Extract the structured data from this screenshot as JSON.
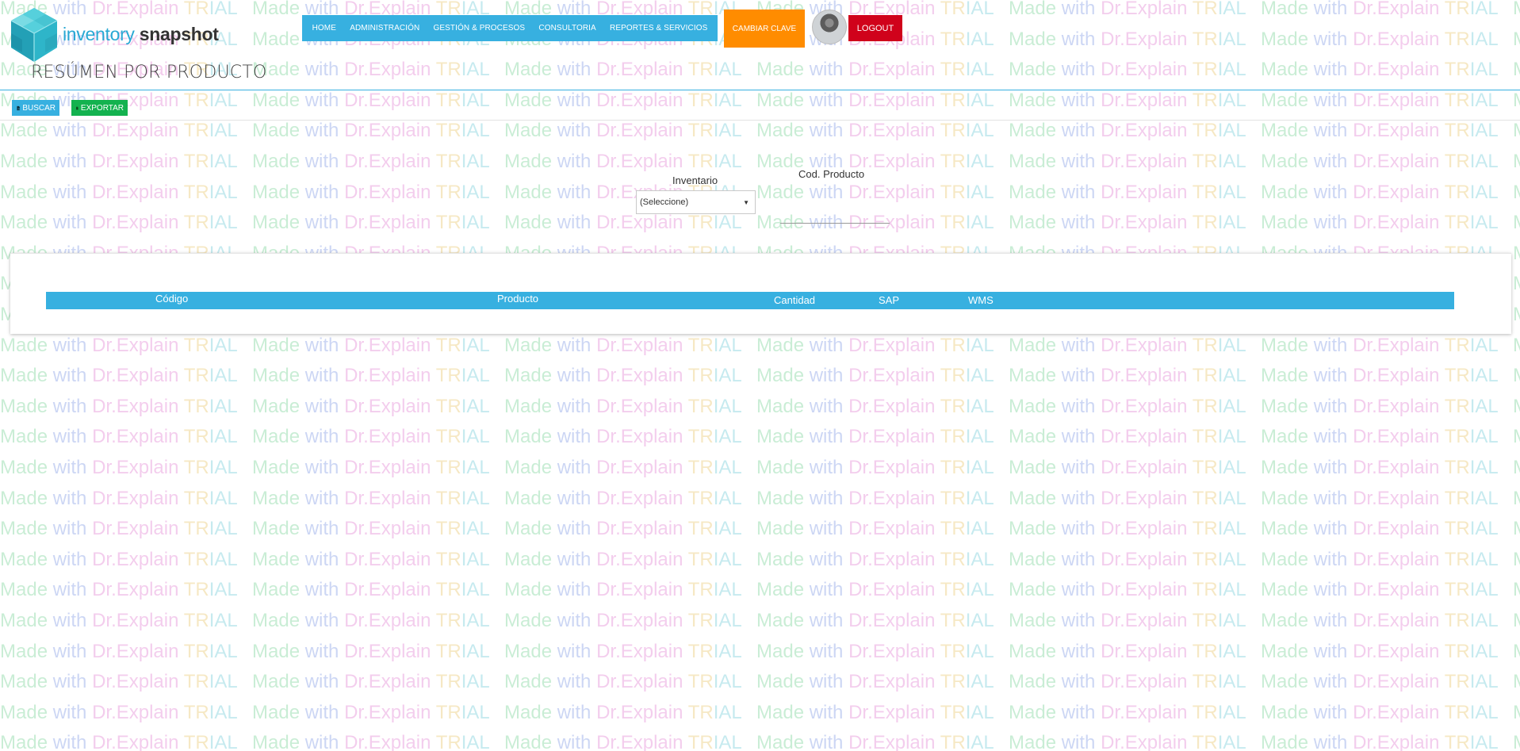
{
  "app": {
    "logo_text_1": "inventory",
    "logo_text_2": "snapshot"
  },
  "nav": {
    "items": [
      {
        "label": "HOME"
      },
      {
        "label": "ADMINISTRACIÓN"
      },
      {
        "label": "GESTIÓN & PROCESOS"
      },
      {
        "label": "CONSULTORIA"
      },
      {
        "label": "REPORTES & SERVICIOS"
      }
    ],
    "change_password": "CAMBIAR CLAVE",
    "logout": "LOGOUT"
  },
  "page": {
    "title": "RESÚMEN POR PRODUCTO"
  },
  "toolbar": {
    "search_label": "BUSCAR",
    "export_label": "EXPORTAR"
  },
  "filters": {
    "inventory_label": "Inventario",
    "inventory_value": "(Seleccione)",
    "product_code_label": "Cod. Producto",
    "product_code_value": ""
  },
  "table": {
    "headers": [
      "Código",
      "Producto",
      "Cantidad",
      "SAP",
      "WMS"
    ],
    "rows": []
  },
  "watermark": {
    "made": "Made",
    "with": "with",
    "brand": "Dr.Explain",
    "trial_1": "TR",
    "trial_2": "IAL"
  },
  "colors": {
    "accent": "#37b0e0",
    "change_password": "#ff8c00",
    "logout": "#d0021b",
    "export": "#13b24f"
  }
}
